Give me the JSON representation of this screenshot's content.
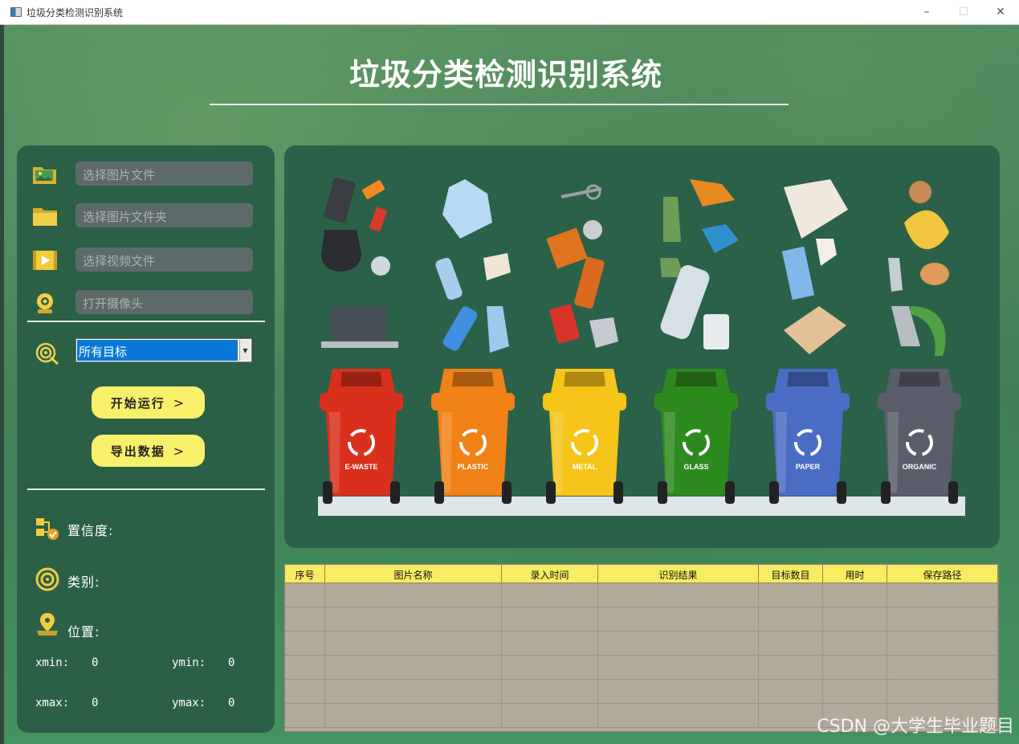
{
  "window": {
    "title": "垃圾分类检测识别系统",
    "controls": {
      "minimize": "–",
      "maximize": "☐",
      "close": "✕"
    }
  },
  "header": {
    "title": "垃圾分类检测识别系统"
  },
  "sidebar": {
    "sources": [
      {
        "label": "选择图片文件",
        "icon": "image-file-icon"
      },
      {
        "label": "选择图片文件夹",
        "icon": "folder-icon"
      },
      {
        "label": "选择视频文件",
        "icon": "video-file-icon"
      },
      {
        "label": "打开摄像头",
        "icon": "camera-icon"
      }
    ],
    "target_select": {
      "value": "所有目标"
    },
    "buttons": {
      "start": "开始运行",
      "export": "导出数据",
      "chevron": ">"
    },
    "info": {
      "confidence_label": "置信度:",
      "category_label": "类别:",
      "position_label": "位置:",
      "xmin_label": "xmin:",
      "xmin_value": "0",
      "ymin_label": "ymin:",
      "ymin_value": "0",
      "xmax_label": "xmax:",
      "xmax_value": "0",
      "ymax_label": "ymax:",
      "ymax_value": "0"
    }
  },
  "display": {
    "bins": [
      {
        "label": "E-WASTE",
        "color": "#d9301e"
      },
      {
        "label": "PLASTIC",
        "color": "#f08218"
      },
      {
        "label": "METAL",
        "color": "#f5c51a"
      },
      {
        "label": "GLASS",
        "color": "#2d8a1f"
      },
      {
        "label": "PAPER",
        "color": "#4b6cc4"
      },
      {
        "label": "ORGANIC",
        "color": "#5a5d6a"
      }
    ]
  },
  "table": {
    "columns": [
      "序号",
      "图片名称",
      "录入时间",
      "识别结果",
      "目标数目",
      "用时",
      "保存路径"
    ],
    "rows": [
      [],
      [],
      [],
      [],
      [],
      []
    ]
  },
  "watermark": "CSDN @大学生毕业题目"
}
